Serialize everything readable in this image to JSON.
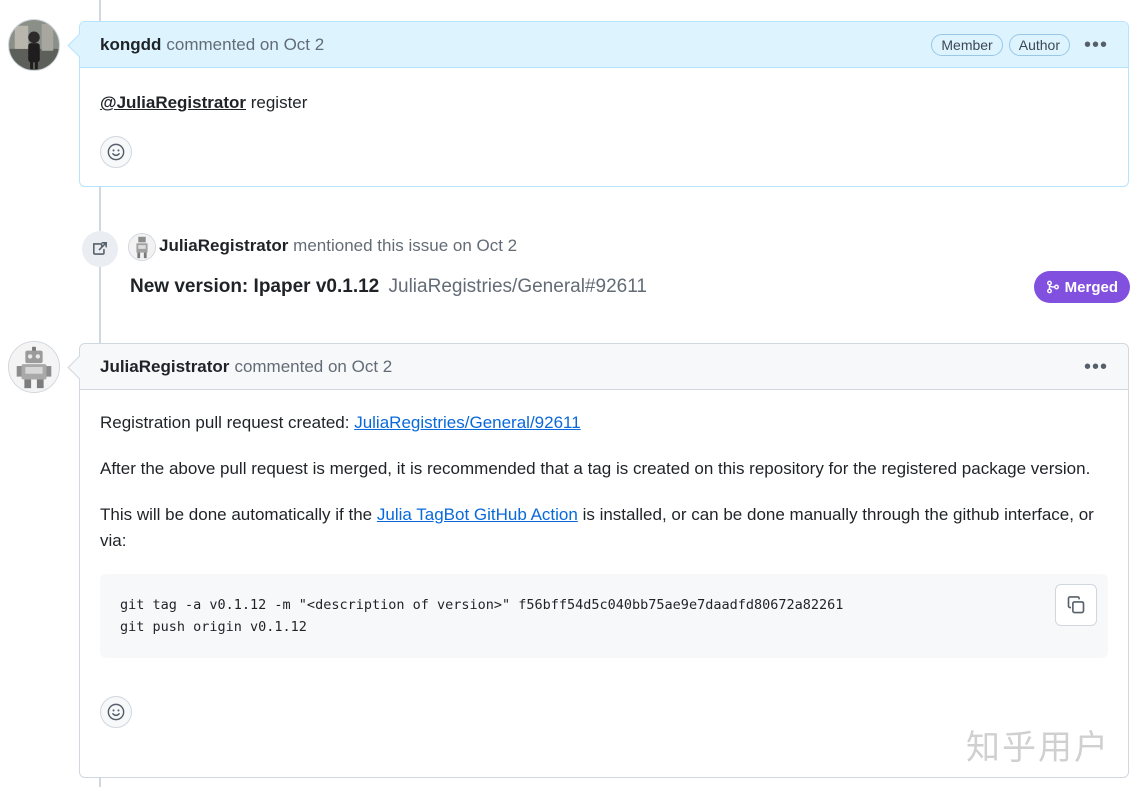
{
  "comment1": {
    "user": "kongdd",
    "meta": "commented on Oct 2",
    "badges": [
      "Member",
      "Author"
    ],
    "body_mention": "@JuliaRegistrator",
    "body_text": " register"
  },
  "event": {
    "user": "JuliaRegistrator",
    "action": "mentioned this issue on Oct 2",
    "title": "New version: Ipaper v0.1.12",
    "ref": "JuliaRegistries/General#92611",
    "status": "Merged"
  },
  "comment2": {
    "user": "JuliaRegistrator",
    "meta": "commented on Oct 2",
    "p1_text": "Registration pull request created: ",
    "p1_link": "JuliaRegistries/General/92611",
    "p2": "After the above pull request is merged, it is recommended that a tag is created on this repository for the registered package version.",
    "p3_before": "This will be done automatically if the ",
    "p3_link": "Julia TagBot GitHub Action",
    "p3_after": " is installed, or can be done manually through the github interface, or via:",
    "code": "git tag -a v0.1.12 -m \"<description of version>\" f56bff54d5c040bb75ae9e7daadfd80672a82261\ngit push origin v0.1.12"
  },
  "watermark": "知乎用户",
  "colors": {
    "merged": "#8250df",
    "link": "#0969da",
    "author_header": "#ddf4ff"
  }
}
